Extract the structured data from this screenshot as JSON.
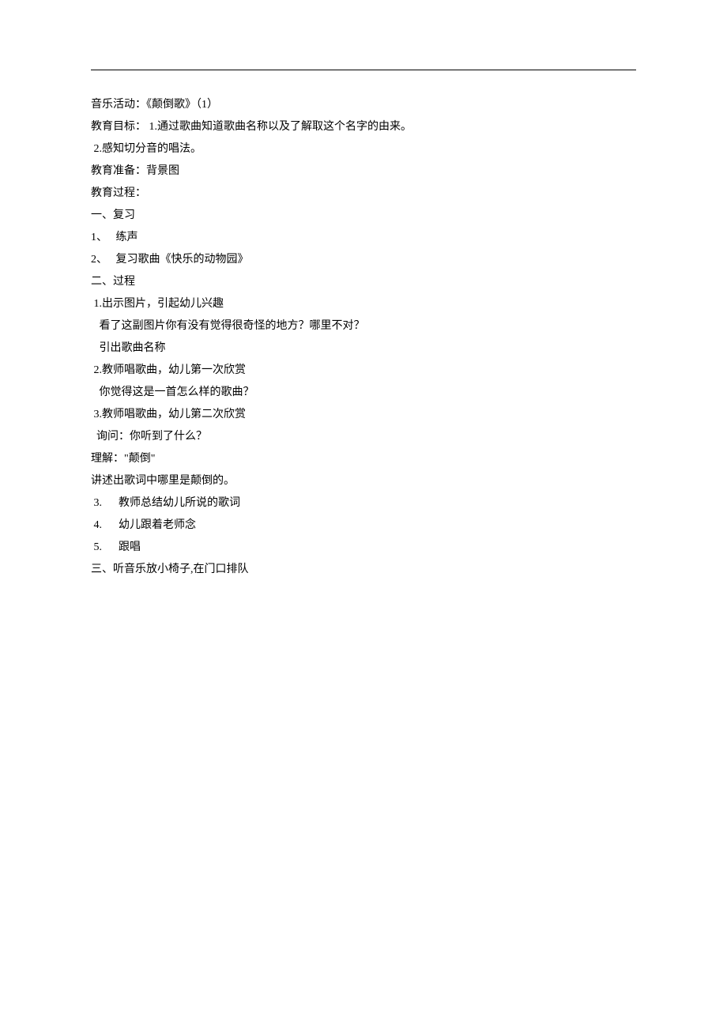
{
  "lines": [
    {
      "text": "音乐活动：《颠倒歌》（1）",
      "indent": ""
    },
    {
      "text": "教育目标： 1.通过歌曲知道歌曲名称以及了解取这个名字的由来。",
      "indent": ""
    },
    {
      "text": " 2.感知切分音的唱法。",
      "indent": ""
    },
    {
      "text": "教育准备：背景图",
      "indent": ""
    },
    {
      "text": "教育过程：",
      "indent": ""
    },
    {
      "text": "一、复习",
      "indent": ""
    },
    {
      "text": "1、   练声",
      "indent": ""
    },
    {
      "text": "2、   复习歌曲《快乐的动物园》",
      "indent": ""
    },
    {
      "text": "二、过程",
      "indent": ""
    },
    {
      "text": " 1.出示图片，引起幼儿兴趣",
      "indent": ""
    },
    {
      "text": "   看了这副图片你有没有觉得很奇怪的地方？哪里不对？",
      "indent": ""
    },
    {
      "text": "   引出歌曲名称",
      "indent": ""
    },
    {
      "text": " 2.教师唱歌曲，幼儿第一次欣赏",
      "indent": ""
    },
    {
      "text": "   你觉得这是一首怎么样的歌曲？",
      "indent": ""
    },
    {
      "text": " 3.教师唱歌曲，幼儿第二次欣赏",
      "indent": ""
    },
    {
      "text": "  询问：你听到了什么？",
      "indent": ""
    },
    {
      "text": "理解：\"颠倒\"",
      "indent": ""
    },
    {
      "text": "讲述出歌词中哪里是颠倒的。",
      "indent": ""
    },
    {
      "text": " 3.      教师总结幼儿所说的歌词",
      "indent": ""
    },
    {
      "text": " 4.      幼儿跟着老师念",
      "indent": ""
    },
    {
      "text": " 5.      跟唱",
      "indent": ""
    },
    {
      "text": "三、听音乐放小椅子,在门口排队",
      "indent": ""
    }
  ]
}
